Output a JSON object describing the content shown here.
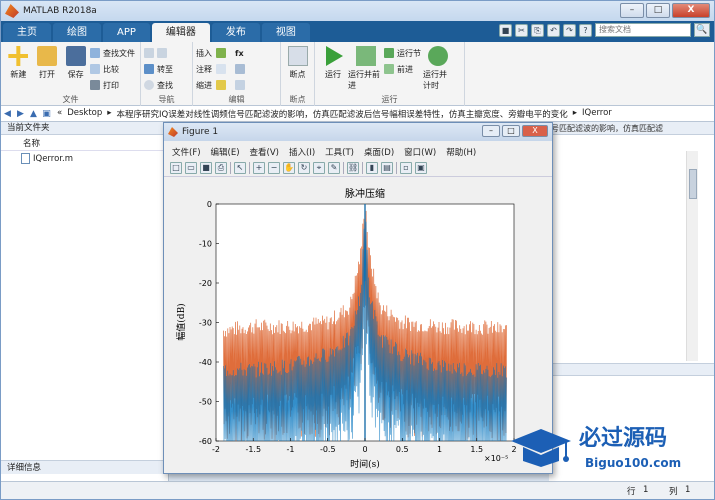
{
  "app": {
    "title": "MATLAB R2018a"
  },
  "window_buttons": {
    "minimize": "–",
    "maximize": "□",
    "close": "X"
  },
  "tabs": [
    {
      "label": "主页",
      "active": false
    },
    {
      "label": "绘图",
      "active": false
    },
    {
      "label": "APP",
      "active": false
    },
    {
      "label": "编辑器",
      "active": true
    },
    {
      "label": "发布",
      "active": false
    },
    {
      "label": "视图",
      "active": false
    }
  ],
  "search": {
    "placeholder": "搜索文档",
    "go": "🔍"
  },
  "ribbon": {
    "file_group": {
      "label": "文件",
      "new": "新建",
      "open": "打开",
      "save": "保存",
      "find_files": "查找文件",
      "compare": "比较",
      "print": "打印"
    },
    "nav_group": {
      "label": "导航",
      "goto": "转至",
      "find": "查找"
    },
    "edit_group": {
      "label": "编辑",
      "insert": "插入",
      "comment": "注释",
      "indent": "缩进",
      "fx": "fx"
    },
    "breakpoint_group": {
      "label": "断点",
      "breakpoints": "断点"
    },
    "run_group": {
      "label": "运行",
      "run": "运行",
      "run_advance": "运行并前进",
      "run_section": "运行节",
      "advance": "前进",
      "run_time": "运行并计时"
    }
  },
  "address": {
    "segments": [
      "Desktop",
      "本程序研究IQ误差对线性调频信号匹配滤波的影响，仿真匹配滤波后信号幅相误差特性，仿真主瓣宽度、旁瓣电平的变化",
      "IQerror"
    ]
  },
  "left_panel": {
    "title": "当前文件夹",
    "column": "名称",
    "files": [
      "IQerror.m"
    ],
    "detail": "详细信息"
  },
  "editor": {
    "tab_text": "号匹配滤波的影响，仿真匹配滤"
  },
  "status": {
    "row_label": "行",
    "row_value": "1",
    "col_label": "列",
    "col_value": "1"
  },
  "figure": {
    "title": "Figure 1",
    "menu": [
      "文件(F)",
      "编辑(E)",
      "查看(V)",
      "插入(I)",
      "工具(T)",
      "桌面(D)",
      "窗口(W)",
      "帮助(H)"
    ],
    "toolbar_icons": [
      "new-icon",
      "open-icon",
      "save-icon",
      "print-icon",
      "pointer-icon",
      "zoom-in-icon",
      "zoom-out-icon",
      "pan-icon",
      "rotate-icon",
      "data-cursor-icon",
      "brush-icon",
      "link-icon",
      "colorbar-icon",
      "legend-icon",
      "hide-tools-icon",
      "show-tools-icon"
    ]
  },
  "chart_data": {
    "type": "line",
    "title": "脉冲压缩",
    "xlabel": "时间(s)",
    "ylabel": "幅值(dB)",
    "x_multiplier": "×10⁻⁵",
    "xlim": [
      -2,
      2
    ],
    "ylim": [
      -60,
      0
    ],
    "xticks": [
      "-2",
      "-1.5",
      "-1",
      "-0.5",
      "0",
      "0.5",
      "1",
      "1.5",
      "2"
    ],
    "yticks": [
      "0",
      "-10",
      "-20",
      "-30",
      "-40",
      "-50",
      "-60"
    ],
    "series": [
      {
        "color": "#d95319",
        "envelope": {
          "x": [
            -1.9,
            -1.5,
            -1.0,
            -0.5,
            -0.2,
            -0.05,
            0,
            0.05,
            0.2,
            0.5,
            1.0,
            1.5,
            1.9
          ],
          "y": [
            -34,
            -33,
            -33,
            -32,
            -28,
            -14,
            0,
            -14,
            -28,
            -32,
            -33,
            -33,
            -34
          ]
        }
      },
      {
        "color": "#0072bd",
        "envelope": {
          "x": [
            -1.9,
            -1.5,
            -1.0,
            -0.5,
            -0.2,
            -0.05,
            0,
            0.05,
            0.2,
            0.5,
            1.0,
            1.5,
            1.9
          ],
          "y": [
            -44,
            -44,
            -43,
            -40,
            -36,
            -24,
            0,
            -24,
            -36,
            -40,
            -43,
            -44,
            -44
          ]
        }
      }
    ],
    "grid": false
  },
  "watermark": {
    "text": "必过源码",
    "url": "Biguo100.com"
  },
  "colors": {
    "accent": "#1d5c96",
    "series1": "#d95319",
    "series2": "#0072bd"
  }
}
